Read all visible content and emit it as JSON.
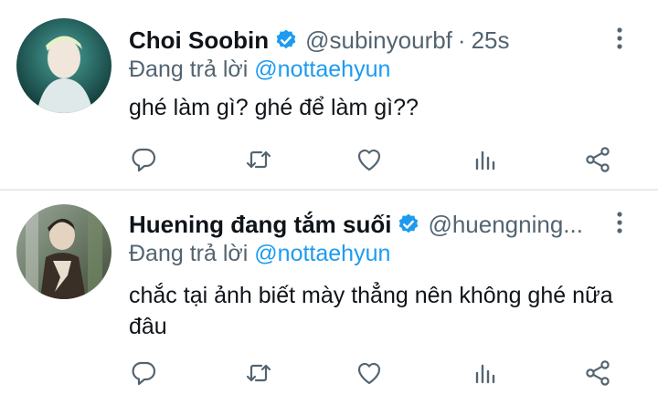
{
  "tweets": [
    {
      "display_name": "Choi Soobin",
      "handle": "@subinyourbf",
      "separator": "·",
      "time": "25s",
      "reply_prefix": "Đang trả lời",
      "reply_to": "@nottaehyun",
      "text": "ghé làm gì? ghé để làm gì??",
      "avatar_colors": [
        "#1f5d5a",
        "#cfe6e2"
      ]
    },
    {
      "display_name": "Huening đang tắm suối",
      "handle": "@huengning...",
      "reply_prefix": "Đang trả lời",
      "reply_to": "@nottaehyun",
      "text": "chắc tại ảnh biết mày thẳng nên không ghé nữa đâu",
      "avatar_colors": [
        "#5c6b4f",
        "#d8d5c8"
      ]
    }
  ],
  "icons": {
    "verified": "verified-badge-icon",
    "more": "more-vertical-icon",
    "reply": "reply-icon",
    "retweet": "retweet-icon",
    "like": "heart-icon",
    "analytics": "analytics-icon",
    "share": "share-icon"
  },
  "colors": {
    "accent": "#1d9bf0",
    "secondary_text": "#536471",
    "primary_text": "#0f1419",
    "icon": "#536471"
  }
}
